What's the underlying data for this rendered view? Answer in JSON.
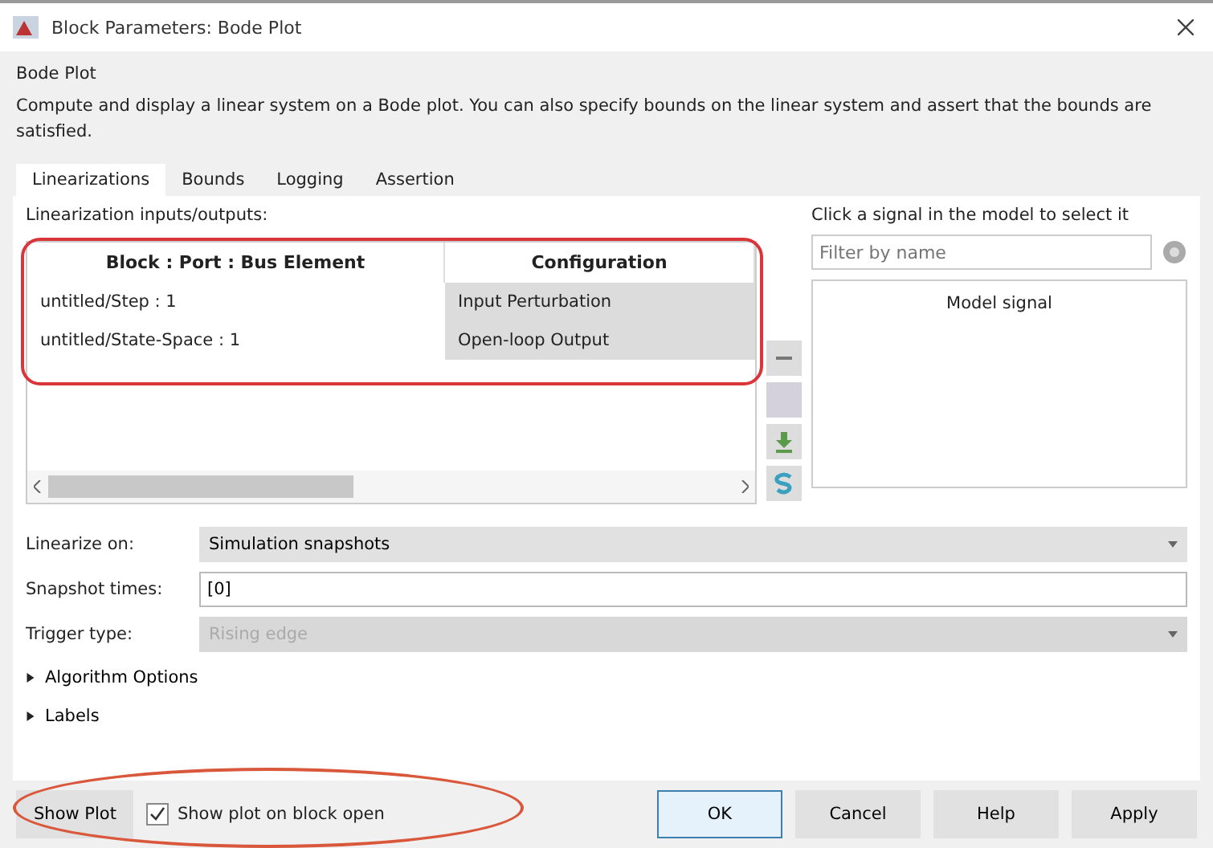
{
  "window": {
    "title": "Block Parameters: Bode Plot"
  },
  "block_name": "Bode Plot",
  "description": "Compute and display a linear system on a Bode plot. You can also specify bounds on the linear system and assert that the bounds are satisfied.",
  "tabs": [
    {
      "label": "Linearizations",
      "selected": true
    },
    {
      "label": "Bounds",
      "selected": false
    },
    {
      "label": "Logging",
      "selected": false
    },
    {
      "label": "Assertion",
      "selected": false
    }
  ],
  "io_label": "Linearization inputs/outputs:",
  "table": {
    "columns": [
      "Block : Port : Bus Element",
      "Configuration"
    ],
    "rows": [
      {
        "block": "untitled/Step : 1",
        "configuration": "Input Perturbation"
      },
      {
        "block": "untitled/State-Space : 1",
        "configuration": "Open-loop Output"
      }
    ]
  },
  "signal_panel": {
    "hint": "Click a signal in the model to select it",
    "filter": {
      "placeholder": "Filter by name"
    },
    "column": "Model signal"
  },
  "form": [
    {
      "kind": "select",
      "label": "Linearize on:",
      "value": "Simulation snapshots",
      "disabled": false
    },
    {
      "kind": "field",
      "label": "Snapshot times:",
      "value": "[0]",
      "disabled": false
    },
    {
      "kind": "select",
      "label": "Trigger type:",
      "value": "Rising edge",
      "disabled": true
    }
  ],
  "sections": [
    {
      "label": "Algorithm Options",
      "expanded": false
    },
    {
      "label": "Labels",
      "expanded": false
    }
  ],
  "show_plot_button": "Show Plot",
  "show_plot_checkbox": {
    "label": "Show plot on block open",
    "checked": true
  },
  "buttons": [
    {
      "label": "OK",
      "default": true
    },
    {
      "label": "Cancel",
      "default": false
    },
    {
      "label": "Help",
      "default": false
    },
    {
      "label": "Apply",
      "default": false
    }
  ]
}
